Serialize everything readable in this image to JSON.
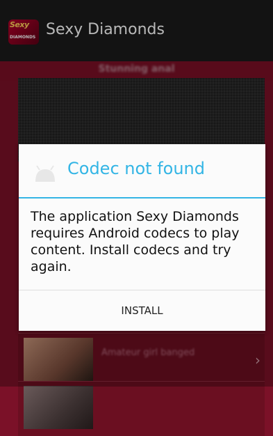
{
  "actionbar": {
    "logo_top": "Sexy",
    "logo_bottom": "DIAMONDS",
    "title": "Sexy Diamonds"
  },
  "background": {
    "header_text": "Stunning anal",
    "rows": [
      {
        "text": "Amateur girl banged",
        "chevron": "›"
      },
      {
        "text": "",
        "chevron": ""
      }
    ]
  },
  "dialog": {
    "icon": "android-icon",
    "title": "Codec not found",
    "message": "The application Sexy Diamonds requires Android codecs to play content. Install codecs and try again.",
    "install_label": "INSTALL"
  },
  "colors": {
    "accent": "#33b5e5",
    "background": "#7b1128",
    "actionbar": "#1b1b1b"
  }
}
